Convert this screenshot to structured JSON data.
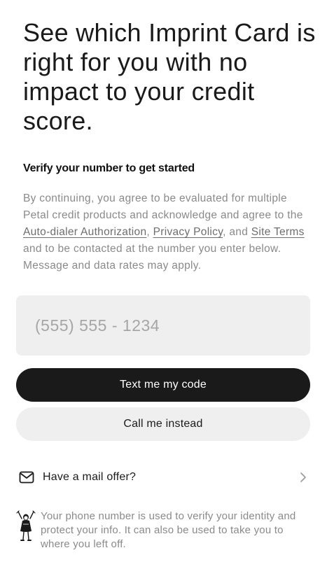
{
  "headline": "See which Imprint Card is right for you with no impact to your credit score.",
  "subhead": "Verify your number to get started",
  "disclaimer": {
    "part1": "By continuing, you agree to be evaluated for multiple Petal credit products and acknowledge and agree to the ",
    "link_autodialer": "Auto-dialer Authorization",
    "sep1": ", ",
    "link_privacy": "Privacy Policy",
    "sep2": ", and ",
    "link_terms": "Site Terms",
    "part2": " and to be contacted at the number you enter below. Message and data rates may apply."
  },
  "phone": {
    "placeholder": "(555) 555 - 1234",
    "value": ""
  },
  "buttons": {
    "text_code": "Text me my code",
    "call_instead": "Call me instead"
  },
  "mail_offer": {
    "label": "Have a mail offer?",
    "icon": "envelope-icon",
    "chevron": "chevron-right-icon"
  },
  "footer": {
    "illustration": "person-illustration-icon",
    "note": "Your phone number is used to verify your identity and protect your info. It can also be used to take you to where you left off."
  },
  "colors": {
    "primary_button": "#1a1a1a",
    "secondary_button": "#efefef",
    "muted_text": "#8a8a8a"
  }
}
